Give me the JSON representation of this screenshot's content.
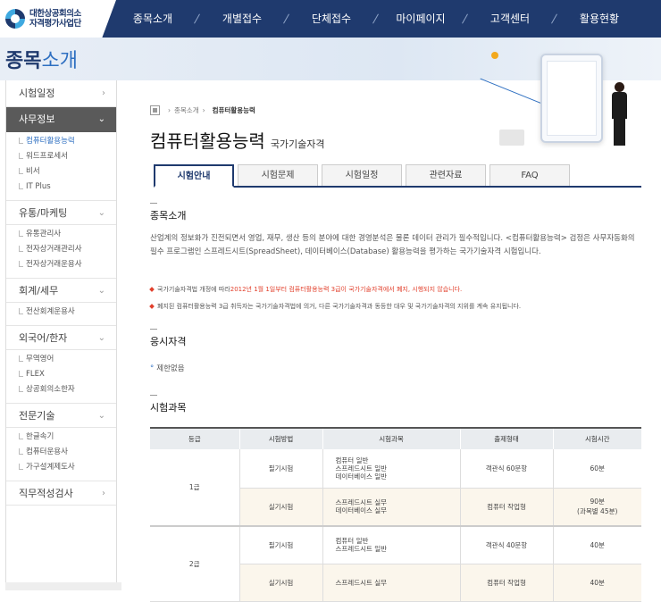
{
  "logo": {
    "line1": "대한상공회의소",
    "line2": "자격평가사업단"
  },
  "nav": [
    "종목소개",
    "개별접수",
    "단체접수",
    "마이페이지",
    "고객센터",
    "활용현황"
  ],
  "banner": {
    "title_bold": "종목",
    "title_rest": "소개"
  },
  "sidebar": {
    "groups": [
      {
        "label": "시험일정",
        "chev": "›",
        "active": false,
        "items": []
      },
      {
        "label": "사무정보",
        "chev": "⌄",
        "active": true,
        "items": [
          "컴퓨터활용능력",
          "워드프로세서",
          "비서",
          "IT Plus"
        ]
      },
      {
        "label": "유통/마케팅",
        "chev": "⌄",
        "active": false,
        "items": [
          "유통관리사",
          "전자상거래관리사",
          "전자상거래운용사"
        ]
      },
      {
        "label": "회계/세무",
        "chev": "⌄",
        "active": false,
        "items": [
          "전산회계운용사"
        ]
      },
      {
        "label": "외국어/한자",
        "chev": "⌄",
        "active": false,
        "items": [
          "무역영어",
          "FLEX",
          "상공회의소한자"
        ]
      },
      {
        "label": "전문기술",
        "chev": "⌄",
        "active": false,
        "items": [
          "한글속기",
          "컴퓨터운용사",
          "가구설계제도사"
        ]
      },
      {
        "label": "직무적성검사",
        "chev": "›",
        "active": false,
        "items": []
      }
    ]
  },
  "breadcrumb": {
    "arrow": "›",
    "parent": "종목소개",
    "current": "컴퓨터활용능력"
  },
  "title": {
    "main": "컴퓨터활용능력",
    "sub": "국가기술자격"
  },
  "tabs": [
    "시험안내",
    "시험문제",
    "시험일정",
    "관련자료",
    "FAQ"
  ],
  "sections": {
    "intro": "종목소개",
    "qualification": "응시자격",
    "subjects": "시험과목"
  },
  "intro_text": "산업계의 정보화가 진전되면서 영업, 재무, 생산 등의 분야에 대한 경영분석은 물론 데이터 관리가 필수적입니다. <컴퓨터활용능력> 검정은 사무자동화의 필수 프로그램인 스프레드시트(SpreadSheet), 데이터베이스(Database) 활용능력을 평가하는 국가기술자격 시험입니다.",
  "notes": [
    {
      "pre": "국가기술자격법 개정에 따라 ",
      "red": "2012년 1월 1일부터 컴퓨터활용능력 3급이 국가기술자격에서 폐지, 시행되지 않습니다.",
      "post": ""
    },
    {
      "pre": "폐지된 컴퓨터활용능력 3급 취득자는 국가기술자격법에 의거, 다른 국가기술자격과 동등한 대우 및 국가기술자격의 지위를 계속 유지됩니다.",
      "red": "",
      "post": ""
    }
  ],
  "qualification_text": "제한없음",
  "table": {
    "headers": [
      "등급",
      "시험방법",
      "시험과목",
      "출제형태",
      "시험시간"
    ],
    "grade1": "1급",
    "grade2": "2급",
    "rows": [
      {
        "method": "필기시험",
        "subjects": [
          "컴퓨터 일반",
          "스프레드시트 일반",
          "데이터베이스 일반"
        ],
        "format": "객관식 60문항",
        "time": "60분",
        "time2": ""
      },
      {
        "method": "실기시험",
        "subjects": [
          "스프레드시트 실무",
          "데이터베이스 실무"
        ],
        "format": "컴퓨터 작업형",
        "time": "90분",
        "time2": "(과목별 45분)"
      },
      {
        "method": "필기시험",
        "subjects": [
          "컴퓨터 일반",
          "스프레드시트 일반"
        ],
        "format": "객관식 40문항",
        "time": "40분",
        "time2": ""
      },
      {
        "method": "실기시험",
        "subjects": [
          "스프레드시트 실무"
        ],
        "format": "컴퓨터 작업형",
        "time": "40분",
        "time2": ""
      }
    ]
  }
}
